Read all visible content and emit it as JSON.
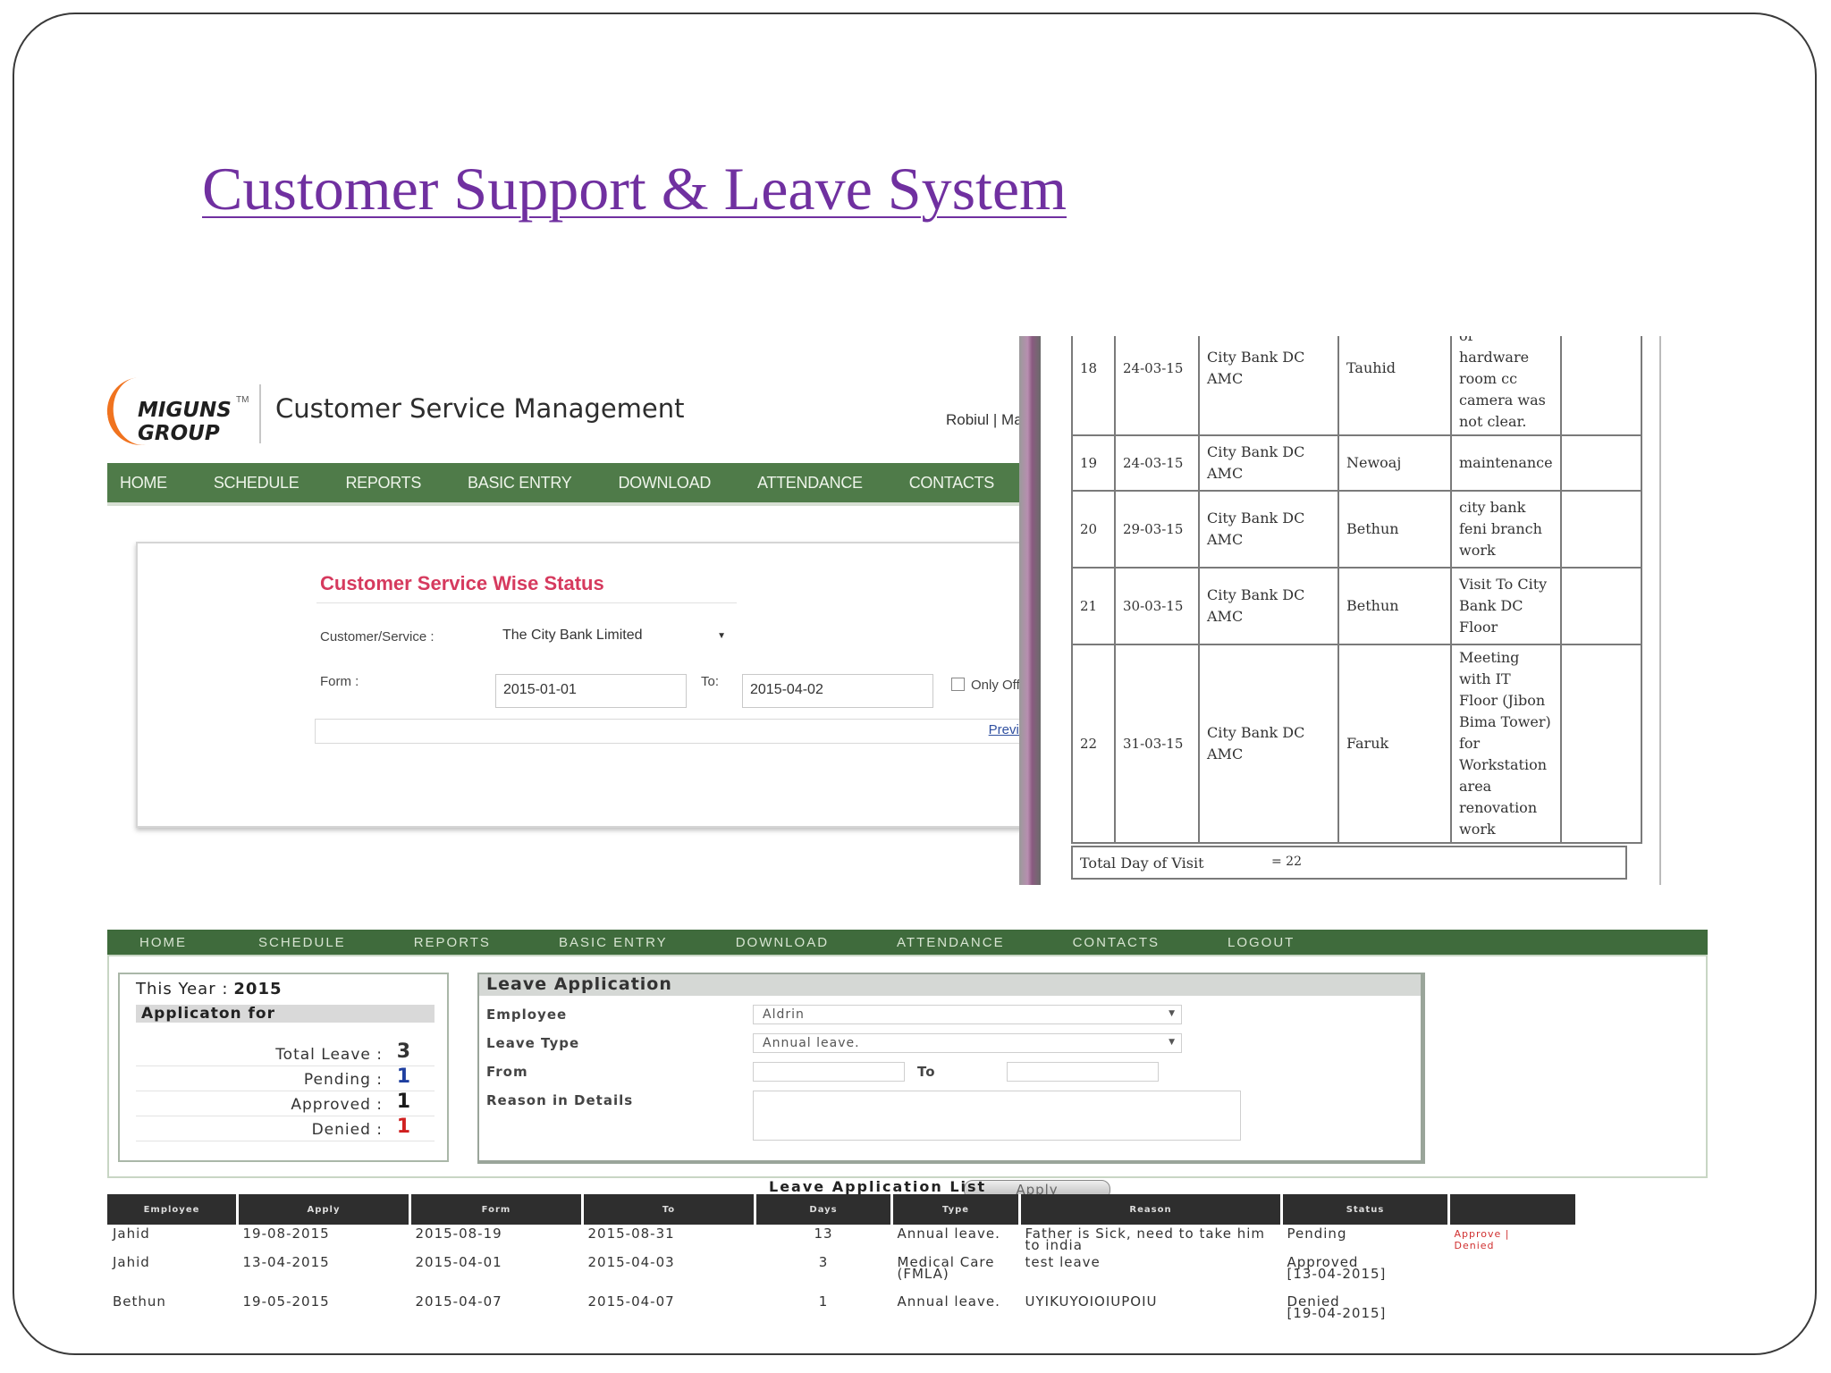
{
  "slide": {
    "title": "Customer Support & Leave System"
  },
  "csm": {
    "logo_line1": "MIGUNS",
    "logo_line2": "GROUP",
    "logo_tm": "TM",
    "app_title": "Customer Service Management",
    "user_name": "Robiul | Ma",
    "nav": [
      "HOME",
      "SCHEDULE",
      "REPORTS",
      "BASIC ENTRY",
      "DOWNLOAD",
      "ATTENDANCE",
      "CONTACTS"
    ],
    "panel_title": "Customer Service Wise Status",
    "customer_label": "Customer/Service :",
    "customer_value": "The City Bank Limited",
    "from_label": "Form :",
    "from_value": "2015-01-01",
    "to_label": "To:",
    "to_value": "2015-04-02",
    "only_office_label": "Only Office",
    "preview_label": "Preview"
  },
  "visits": {
    "top_fragment": "The image of",
    "rows": [
      {
        "sl": "18",
        "date": "24-03-15",
        "client": "City Bank DC AMC",
        "engineer": "Tauhid",
        "work": "hardware room cc camera was not clear."
      },
      {
        "sl": "19",
        "date": "24-03-15",
        "client": "City Bank DC AMC",
        "engineer": "Newoaj",
        "work": "maintenance"
      },
      {
        "sl": "20",
        "date": "29-03-15",
        "client": "City Bank DC AMC",
        "engineer": "Bethun",
        "work": "city bank feni branch work"
      },
      {
        "sl": "21",
        "date": "30-03-15",
        "client": "City Bank DC AMC",
        "engineer": "Bethun",
        "work": "Visit To City Bank DC Floor"
      },
      {
        "sl": "22",
        "date": "31-03-15",
        "client": "City Bank DC AMC",
        "engineer": "Faruk",
        "work": "Meeting with IT Floor (Jibon Bima Tower) for Workstation area renovation work"
      }
    ],
    "total_label": "Total Day of Visit",
    "total_value": "= 22"
  },
  "leave": {
    "nav": [
      "HOME",
      "SCHEDULE",
      "REPORTS",
      "BASIC ENTRY",
      "DOWNLOAD",
      "ATTENDANCE",
      "CONTACTS",
      "LOGOUT"
    ],
    "this_year_label": "This Year :",
    "this_year_value": "2015",
    "application_for_label": "Applicaton for",
    "summary": [
      {
        "label": "Total Leave :",
        "value": "3",
        "color": "#333333"
      },
      {
        "label": "Pending :",
        "value": "1",
        "color": "#1f3fa0"
      },
      {
        "label": "Approved :",
        "value": "1",
        "color": "#1a1a1a"
      },
      {
        "label": "Denied :",
        "value": "1",
        "color": "#d02020"
      }
    ],
    "form_title": "Leave Application",
    "employee_label": "Employee",
    "employee_value": "Aldrin",
    "leave_type_label": "Leave Type",
    "leave_type_value": "Annual leave.",
    "from_label": "From",
    "to_label": "To",
    "reason_label": "Reason in Details",
    "apply_label": "Apply",
    "list_title": "Leave Application List",
    "columns": [
      "Employee",
      "Apply",
      "Form",
      "To",
      "Days",
      "Type",
      "Reason",
      "Status",
      ""
    ],
    "rows": [
      {
        "employee": "Jahid",
        "apply": "19-08-2015",
        "form": "2015-08-19",
        "to": "2015-08-31",
        "days": "13",
        "type": "Annual leave.",
        "reason": "Father is Sick, need to take him to india",
        "status": "Pending",
        "status_note": "",
        "action_approve": "Approve |",
        "action_deny": "Denied"
      },
      {
        "employee": "Jahid",
        "apply": "13-04-2015",
        "form": "2015-04-01",
        "to": "2015-04-03",
        "days": "3",
        "type": "Medical Care (FMLA)",
        "reason": "test leave",
        "status": "Approved",
        "status_note": "[13-04-2015]",
        "action_approve": "",
        "action_deny": ""
      },
      {
        "employee": "Bethun",
        "apply": "19-05-2015",
        "form": "2015-04-07",
        "to": "2015-04-07",
        "days": "1",
        "type": "Annual leave.",
        "reason": "UYIKUYOIOIUPOIU",
        "status": "Denied",
        "status_note": "[19-04-2015]",
        "action_approve": "",
        "action_deny": ""
      }
    ]
  },
  "colors": {
    "title_purple": "#7030a0",
    "nav_green": "#4f7b49",
    "panel_title_pink": "#d63a5e"
  }
}
